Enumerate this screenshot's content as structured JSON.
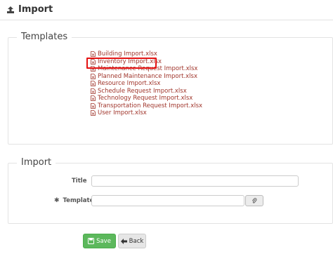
{
  "header": {
    "title": "Import",
    "icon": "upload-icon"
  },
  "templates": {
    "legend": "Templates",
    "items": [
      "Building Import.xlsx",
      "Inventory Import.xlsx",
      "Maintenance Request Import.xlsx",
      "Planned Maintenance Import.xlsx",
      "Resource Import.xlsx",
      "Schedule Request Import.xlsx",
      "Technology Request Import.xlsx",
      "Transportation Request Import.xlsx",
      "User Import.xlsx"
    ],
    "highlighted_index": 1,
    "link_color": "#a0352b",
    "highlight_color": "#e41212"
  },
  "import_form": {
    "legend": "Import",
    "title_label": "Title",
    "title_value": "",
    "template_label": "Template",
    "template_required_mark": "✱",
    "template_value": ""
  },
  "actions": {
    "save_label": "Save",
    "back_label": "Back",
    "save_color": "#5cb85c"
  }
}
